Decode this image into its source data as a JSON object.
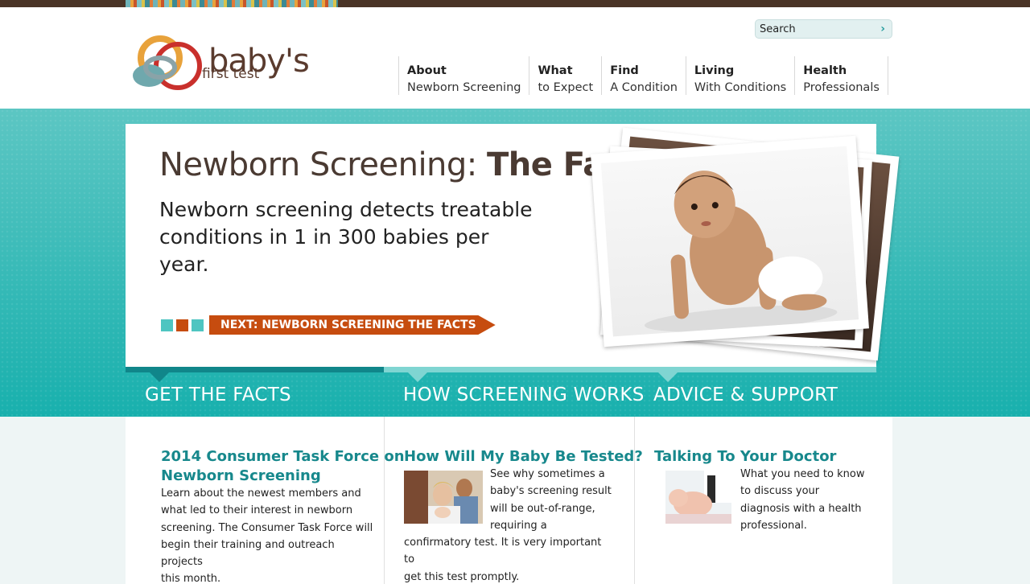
{
  "brand": {
    "word": "baby's",
    "sub": "first test",
    "colors": {
      "ring_red": "#c9302c",
      "ring_yellow": "#e8a23b",
      "ring_teal": "#6fa8ad",
      "ring_gray": "#8aa3a8",
      "text": "#5a3b2e"
    }
  },
  "search": {
    "placeholder": "Search",
    "go_icon": "chevron-right-icon"
  },
  "nav": [
    {
      "bold": "About",
      "rest": "Newborn Screening"
    },
    {
      "bold": "What",
      "rest": "to Expect"
    },
    {
      "bold": "Find",
      "rest": "A Condition"
    },
    {
      "bold": "Living",
      "rest": "With Conditions"
    },
    {
      "bold": "Health",
      "rest": "Professionals"
    }
  ],
  "hero": {
    "title_regular": "Newborn Screening: ",
    "title_bold": "The Facts",
    "lead_line1": "Newborn  screening detects treatable",
    "lead_line2": "conditions in 1 in 300 babies per year.",
    "next_label": "NEXT: NEWBORN SCREENING THE FACTS",
    "dot_colors": [
      "#4ec5c1",
      "#c64c0f",
      "#4ec5c1"
    ]
  },
  "tabs": [
    {
      "label": "GET THE FACTS"
    },
    {
      "label": "HOW SCREENING WORKS"
    },
    {
      "label": "ADVICE & SUPPORT"
    }
  ],
  "articles": [
    {
      "title_line1": "2014 Consumer Task Force on",
      "title_line2": "Newborn Screening",
      "body_lines": [
        "Learn about the newest members and",
        "what led to their interest in newborn",
        "screening. The Consumer Task Force will",
        "begin their training and outreach projects",
        "this month."
      ]
    },
    {
      "title_line1": "How Will My Baby Be Tested?",
      "body_lines": [
        "See why sometimes a",
        "baby's screening result",
        "will be out-of-range,",
        "requiring a",
        "confirmatory  test. It is very important to",
        "get this test promptly."
      ]
    },
    {
      "title_line1": "Talking To Your Doctor",
      "body_lines": [
        "What you need to know",
        "to discuss your",
        "diagnosis with a health",
        "professional."
      ]
    }
  ]
}
